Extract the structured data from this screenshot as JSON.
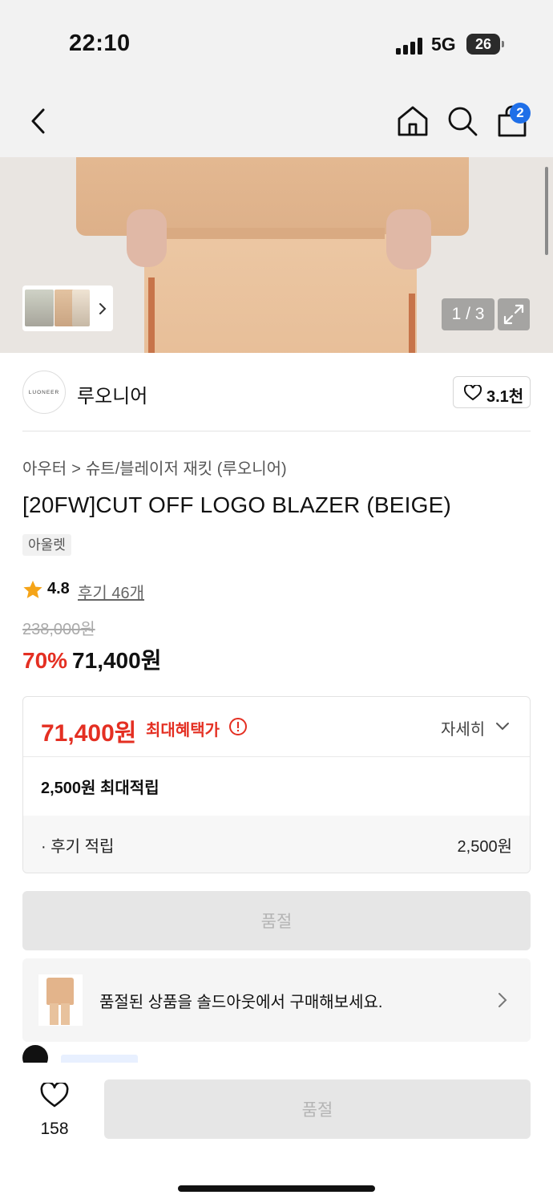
{
  "status_bar": {
    "time": "22:10",
    "network": "5G",
    "battery": "26"
  },
  "nav": {
    "back_icon": "chevron-left-icon",
    "home_icon": "home-icon",
    "search_icon": "search-icon",
    "cart_icon": "shopping-bag-icon",
    "cart_count": "2"
  },
  "gallery": {
    "counter": "1 / 3",
    "expand_icon": "expand-icon"
  },
  "brand": {
    "logo_text": "LUONEER",
    "name": "루오니어",
    "likes": "3.1천"
  },
  "product": {
    "breadcrumb": [
      "아우터",
      "슈트/블레이저 재킷 (루오니어)"
    ],
    "breadcrumb_separator": ">",
    "title": "[20FW]CUT OFF LOGO BLAZER (BEIGE)",
    "badge": "아울렛",
    "rating": "4.8",
    "review_link": "후기 46개",
    "original_price": "238,000원",
    "discount": "70%",
    "sale_price": "71,400원"
  },
  "benefit": {
    "max_price": "71,400원",
    "max_label": "최대혜택가",
    "detail_label": "자세히",
    "points_label": "2,500원 최대적립",
    "review_points_label": "· 후기 적립",
    "review_points_value": "2,500원"
  },
  "soldout_button": "품절",
  "soldout_banner": {
    "text": "품절된 상품을 솔드아웃에서 구매해보세요."
  },
  "bottom_bar": {
    "wish_count": "158",
    "buy_label": "품절"
  },
  "colors": {
    "accent_red": "#e42f22",
    "badge_blue": "#1f6fe8",
    "disabled_bg": "#e6e6e6"
  }
}
